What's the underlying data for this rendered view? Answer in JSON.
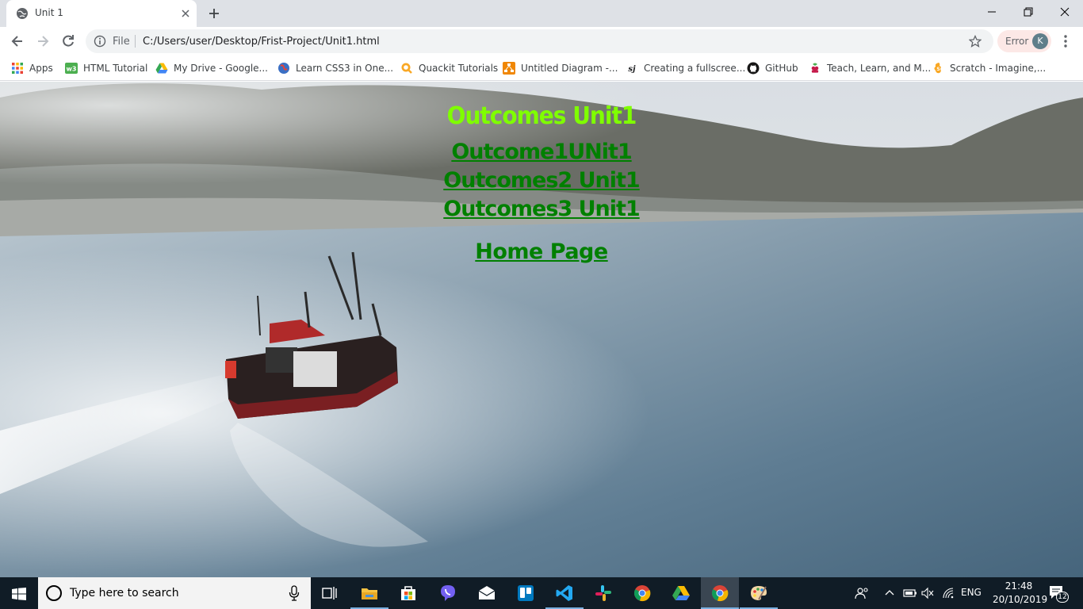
{
  "browser": {
    "tab_title": "Unit 1",
    "address_prefix": "File",
    "url": "C:/Users/user/Desktop/Frist-Project/Unit1.html",
    "profile_status": "Error",
    "profile_initial": "K"
  },
  "bookmarks": [
    {
      "label": "Apps",
      "icon": "apps-grid-icon"
    },
    {
      "label": "HTML Tutorial",
      "icon": "w3schools-icon"
    },
    {
      "label": "My Drive - Google...",
      "icon": "google-drive-icon"
    },
    {
      "label": "Learn CSS3 in One...",
      "icon": "globe-icon"
    },
    {
      "label": "Quackit Tutorials",
      "icon": "quackit-icon"
    },
    {
      "label": "Untitled Diagram -...",
      "icon": "drawio-icon"
    },
    {
      "label": "Creating a fullscree...",
      "icon": "sj-icon"
    },
    {
      "label": "GitHub",
      "icon": "github-icon"
    },
    {
      "label": "Teach, Learn, and M...",
      "icon": "raspberry-icon"
    },
    {
      "label": "Scratch - Imagine,...",
      "icon": "scratch-icon"
    }
  ],
  "page": {
    "heading": "Outcomes Unit1",
    "links": [
      "Outcome1UNit1",
      "Outcomes2 Unit1",
      "Outcomes3 Unit1"
    ],
    "home_link": "Home Page",
    "heading_color": "#7fff00",
    "link_color": "#008000"
  },
  "taskbar": {
    "search_placeholder": "Type here to search",
    "language": "ENG",
    "time": "21:48",
    "date": "20/10/2019",
    "notification_count": "12",
    "apps": [
      "task-view-icon",
      "file-explorer-icon",
      "store-icon",
      "viber-icon",
      "mail-icon",
      "trello-icon",
      "vscode-icon",
      "slack-icon",
      "chrome-icon",
      "google-drive-icon",
      "chrome-active-icon",
      "paint-icon"
    ]
  }
}
